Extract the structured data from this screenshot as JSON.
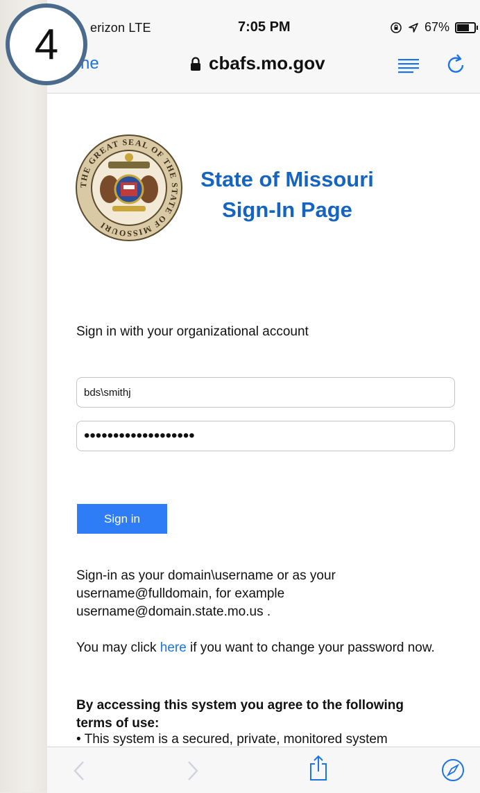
{
  "step_badge": "4",
  "status_bar": {
    "carrier": "erizon  LTE",
    "time": "7:05 PM",
    "battery_percent": "67%",
    "battery_level": 0.67
  },
  "address_bar": {
    "done_label": "ne",
    "url": "cbafs.mo.gov"
  },
  "page": {
    "title_line1": "State of Missouri",
    "title_line2": "Sign-In Page",
    "seal_text": "THE GREAT SEAL OF THE STATE OF MISSOURI",
    "signin_heading": "Sign in with your organizational account",
    "username_value": "bds\\smithj",
    "password_value": "•••••••••••••••••••",
    "signin_button": "Sign in",
    "help_text": "Sign-in as your domain\\username or as your username@fulldomain, for example username@domain.state.mo.us .",
    "pw_prefix": "You may click ",
    "pw_link": "here",
    "pw_suffix": " if you want to change your password now.",
    "terms_heading": "By accessing this system you agree to the following terms of use:",
    "terms_line1": "• This system is a secured, private, monitored system"
  },
  "icons": {
    "lock": "lock-icon",
    "reader": "reader-icon",
    "reload": "reload-icon",
    "back": "back-icon",
    "forward": "forward-icon",
    "share": "share-icon",
    "safari": "compass-icon"
  },
  "colors": {
    "link": "#1a73e8",
    "title": "#1565c0",
    "button": "#2f7df6",
    "badge_border": "#4a6b8c"
  }
}
